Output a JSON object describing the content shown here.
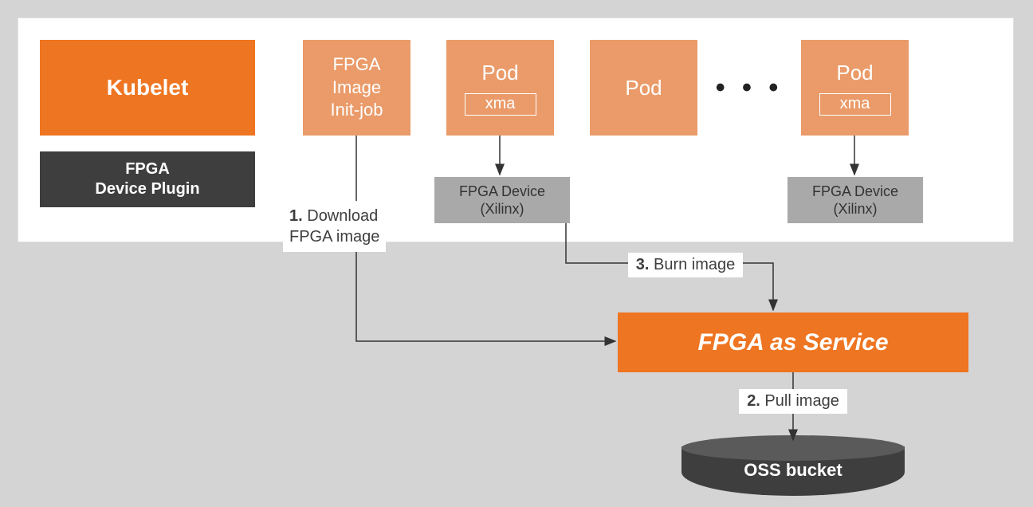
{
  "panel": {},
  "kubelet": {
    "label": "Kubelet"
  },
  "device_plugin": {
    "line1": "FPGA",
    "line2": "Device Plugin"
  },
  "init_job": {
    "line1": "FPGA",
    "line2": "Image",
    "line3": "Init-job"
  },
  "pod1": {
    "label": "Pod",
    "xma": "xma"
  },
  "pod2": {
    "label": "Pod"
  },
  "dots": "• • •",
  "pod3": {
    "label": "Pod",
    "xma": "xma"
  },
  "fpga_dev1": {
    "line1": "FPGA Device",
    "line2": "(Xilinx)"
  },
  "fpga_dev2": {
    "line1": "FPGA Device",
    "line2": "(Xilinx)"
  },
  "step1": {
    "num": "1.",
    "text": " Download\nFPGA image"
  },
  "step2": {
    "num": "2.",
    "text": " Pull image"
  },
  "step3": {
    "num": "3.",
    "text": "  Burn image"
  },
  "faas": {
    "label": "FPGA as Service"
  },
  "oss": {
    "label": "OSS bucket"
  }
}
